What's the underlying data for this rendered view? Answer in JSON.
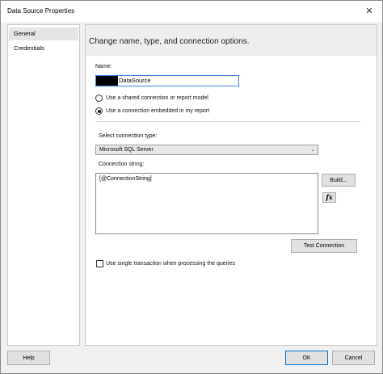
{
  "window": {
    "title": "Data Source Properties",
    "close_glyph": "✕"
  },
  "nav": {
    "items": [
      {
        "label": "General",
        "selected": true
      },
      {
        "label": "Credentials",
        "selected": false
      }
    ]
  },
  "main": {
    "heading": "Change name, type, and connection options.",
    "name_label": "Name:",
    "name_value": "DataSource",
    "radio_shared": "Use a shared connection or report model",
    "radio_embedded": "Use a connection embedded in my report",
    "connection_type_label": "Select connection type:",
    "connection_type_value": "Microsoft SQL Server",
    "connection_string_label": "Connection string:",
    "connection_string_value": "[@ConnectionString]",
    "build_button": "Build...",
    "fx_button": "fx",
    "test_connection_button": "Test Connection",
    "single_transaction_label": "Use single transaction when processing the queries"
  },
  "footer": {
    "help": "Help",
    "ok": "OK",
    "cancel": "Cancel"
  }
}
